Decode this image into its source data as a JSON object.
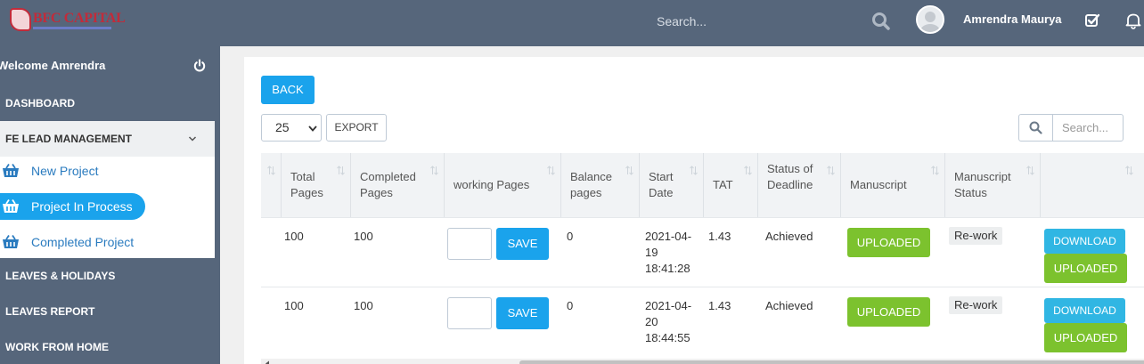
{
  "app": {
    "logo_text": "BFC CAPITAL"
  },
  "topbar": {
    "search_placeholder": "Search...",
    "user_name": "Amrendra Maurya"
  },
  "sidebar": {
    "welcome": "Welcome Amrendra",
    "items": [
      {
        "label": "DASHBOARD"
      },
      {
        "label": "FE LEAD MANAGEMENT",
        "expanded": true,
        "children": [
          {
            "label": "New Project"
          },
          {
            "label": "Project In Process",
            "active": true
          },
          {
            "label": "Completed Project"
          }
        ]
      },
      {
        "label": "LEAVES & HOLIDAYS"
      },
      {
        "label": "LEAVES REPORT"
      },
      {
        "label": "WORK FROM HOME"
      }
    ]
  },
  "main": {
    "back_label": "BACK",
    "page_size": "25",
    "export_label": "EXPORT",
    "table_search_placeholder": "Search...",
    "columns": [
      "",
      "Total Pages",
      "Completed Pages",
      "working Pages",
      "Balance pages",
      "Start Date",
      "TAT",
      "Status of Deadline",
      "Manuscript",
      "Manuscript Status",
      ""
    ],
    "rows": [
      {
        "total": "100",
        "completed": "100",
        "save_label": "SAVE",
        "balance": "0",
        "start_date": "2021-04-19 18:41:28",
        "tat": "1.43",
        "status": "Achieved",
        "manuscript": "UPLOADED",
        "manuscript_status": "Re-work",
        "download_label": "DOWNLOAD",
        "uploaded2": "UPLOADED"
      },
      {
        "total": "100",
        "completed": "100",
        "save_label": "SAVE",
        "balance": "0",
        "start_date": "2021-04-20 18:44:55",
        "tat": "1.43",
        "status": "Achieved",
        "manuscript": "UPLOADED",
        "manuscript_status": "Re-work",
        "download_label": "DOWNLOAD",
        "uploaded2": "UPLOADED"
      }
    ]
  },
  "colors": {
    "topbar": "#56667b",
    "accent": "#1aa3ec",
    "success": "#7cc22e",
    "info": "#30b6e3"
  }
}
